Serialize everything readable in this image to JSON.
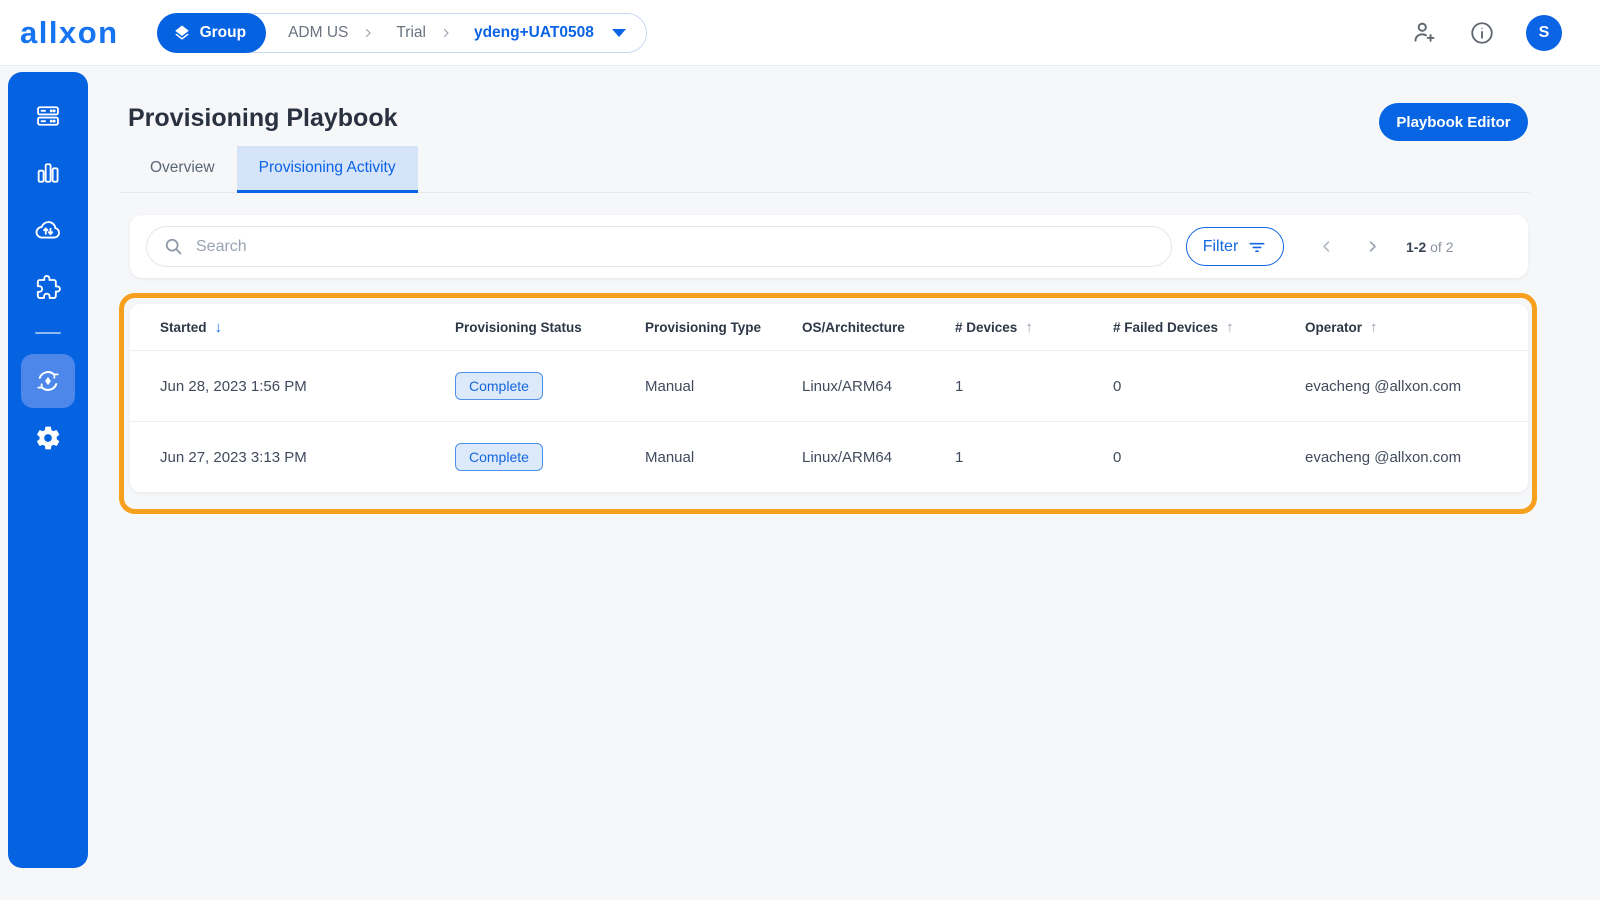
{
  "colors": {
    "primary": "#0562E0",
    "sidebar_active_bg": "#4C87E9",
    "tab_active_bg": "#D6E4F9",
    "highlight_border": "#F7A01D",
    "badge_bg": "#DCE9FB",
    "badge_border": "#4F90EA",
    "badge_text": "#1566DC"
  },
  "topbar": {
    "logo": "allxon",
    "group_button": {
      "label": "Group",
      "icon": "layers-icon"
    },
    "breadcrumb": {
      "org": "ADM US",
      "group": "Trial",
      "current": "ydeng+UAT0508"
    },
    "icons": {
      "invite": "person-add-icon",
      "help": "info-icon"
    },
    "avatar_letter": "S"
  },
  "sidebar": {
    "items": [
      {
        "icon": "devices-icon",
        "active": false
      },
      {
        "icon": "analytics-icon",
        "active": false
      },
      {
        "icon": "ota-cloud-icon",
        "active": false
      },
      {
        "icon": "plugins-icon",
        "active": false
      },
      {
        "icon": "provisioning-icon",
        "active": true
      },
      {
        "icon": "settings-icon",
        "active": false
      }
    ]
  },
  "page": {
    "title": "Provisioning Playbook",
    "editor_button": "Playbook Editor",
    "tabs": [
      {
        "label": "Overview",
        "active": false
      },
      {
        "label": "Provisioning Activity",
        "active": true
      }
    ]
  },
  "toolbar": {
    "search_placeholder": "Search",
    "filter_label": "Filter",
    "pagination": {
      "range": "1-2",
      "suffix": "of 2"
    }
  },
  "table": {
    "columns": [
      {
        "label": "Started",
        "sort": "desc"
      },
      {
        "label": "Provisioning Status",
        "sort": null
      },
      {
        "label": "Provisioning Type",
        "sort": null
      },
      {
        "label": "OS/Architecture",
        "sort": null
      },
      {
        "label": "# Devices",
        "sort": "asc"
      },
      {
        "label": "# Failed Devices",
        "sort": "asc"
      },
      {
        "label": "Operator",
        "sort": "asc"
      }
    ],
    "rows": [
      {
        "started": "Jun 28, 2023 1:56 PM",
        "status": "Complete",
        "type": "Manual",
        "os": "Linux/ARM64",
        "devices": "1",
        "failed_devices": "0",
        "operator": "evacheng @allxon.com"
      },
      {
        "started": "Jun 27, 2023 3:13 PM",
        "status": "Complete",
        "type": "Manual",
        "os": "Linux/ARM64",
        "devices": "1",
        "failed_devices": "0",
        "operator": "evacheng @allxon.com"
      }
    ]
  }
}
